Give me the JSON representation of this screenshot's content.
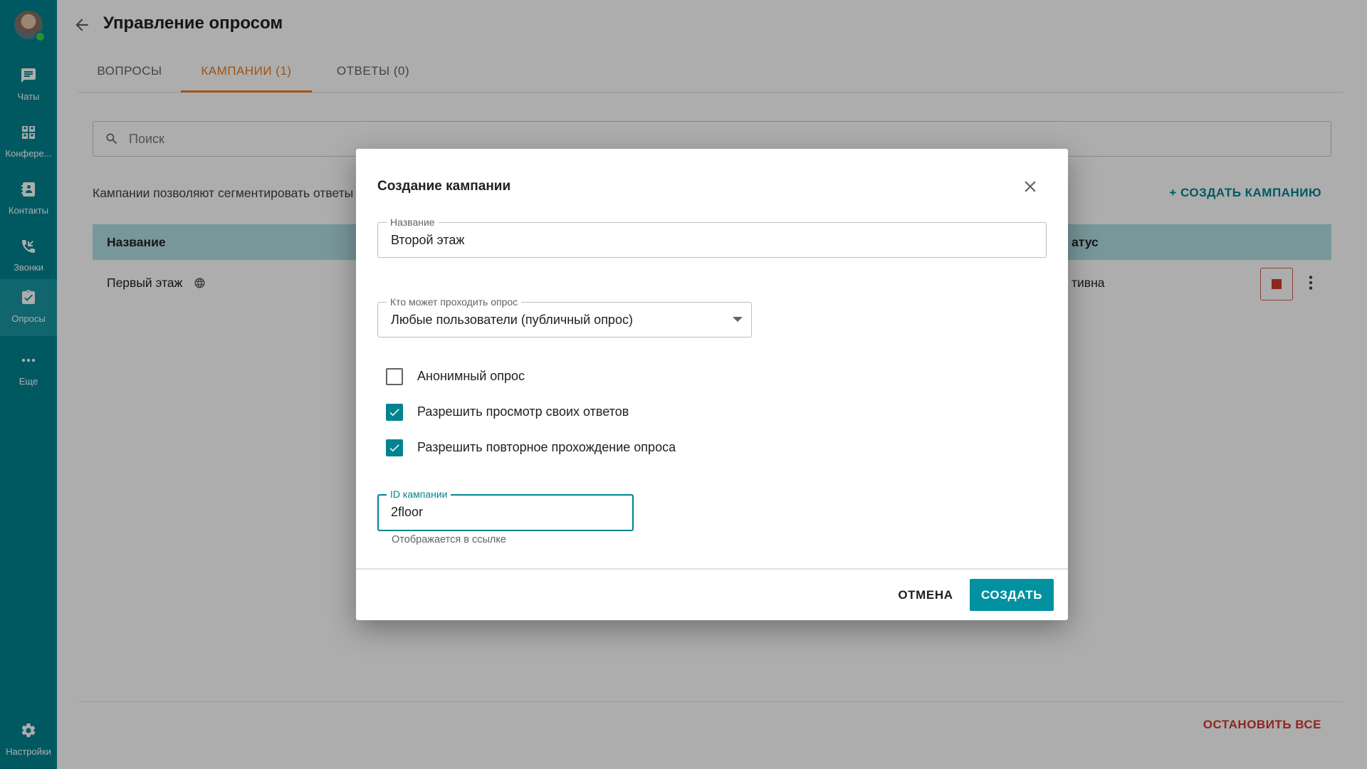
{
  "colors": {
    "accent": "#00838f",
    "sidebar_bg": "#00838f",
    "active_tab": "#f07a1a",
    "danger": "#d23a2c",
    "table_header_bg": "#b2dfe3"
  },
  "sidebar": {
    "items": [
      {
        "label": "Чаты",
        "icon": "chat-icon"
      },
      {
        "label": "Конфере...",
        "icon": "conference-icon"
      },
      {
        "label": "Контакты",
        "icon": "contacts-icon"
      },
      {
        "label": "Звонки",
        "icon": "phone-icon"
      },
      {
        "label": "Опросы",
        "icon": "survey-icon",
        "active": true
      },
      {
        "label": "Еще",
        "icon": "more-horizontal-icon"
      }
    ],
    "settings_label": "Настройки"
  },
  "header": {
    "title": "Управление опросом"
  },
  "tabs": [
    {
      "label": "ВОПРОСЫ"
    },
    {
      "label": "КАМПАНИИ (1)",
      "active": true
    },
    {
      "label": "ОТВЕТЫ (0)"
    }
  ],
  "search": {
    "placeholder": "Поиск"
  },
  "campaigns": {
    "description": "Кампании позволяют сегментировать ответы",
    "create_label": "+ СОЗДАТЬ КАМПАНИЮ",
    "columns": {
      "name": "Название",
      "status": "атус"
    },
    "rows": [
      {
        "name": "Первый этаж",
        "status": "тивна",
        "icon": "globe-icon"
      }
    ],
    "stop_all_label": "ОСТАНОВИТЬ ВСЕ"
  },
  "dialog": {
    "title": "Создание кампании",
    "name_field": {
      "label": "Название",
      "value": "Второй этаж"
    },
    "access_field": {
      "label": "Кто может проходить опрос",
      "value": "Любые пользователи (публичный опрос)"
    },
    "checkboxes": [
      {
        "label": "Анонимный опрос",
        "checked": false
      },
      {
        "label": "Разрешить просмотр своих ответов",
        "checked": true
      },
      {
        "label": "Разрешить повторное прохождение опроса",
        "checked": true
      }
    ],
    "id_field": {
      "label": "ID кампании",
      "value": "2floor",
      "helper": "Отображается в ссылке"
    },
    "cancel_label": "ОТМЕНА",
    "create_label": "СОЗДАТЬ"
  }
}
